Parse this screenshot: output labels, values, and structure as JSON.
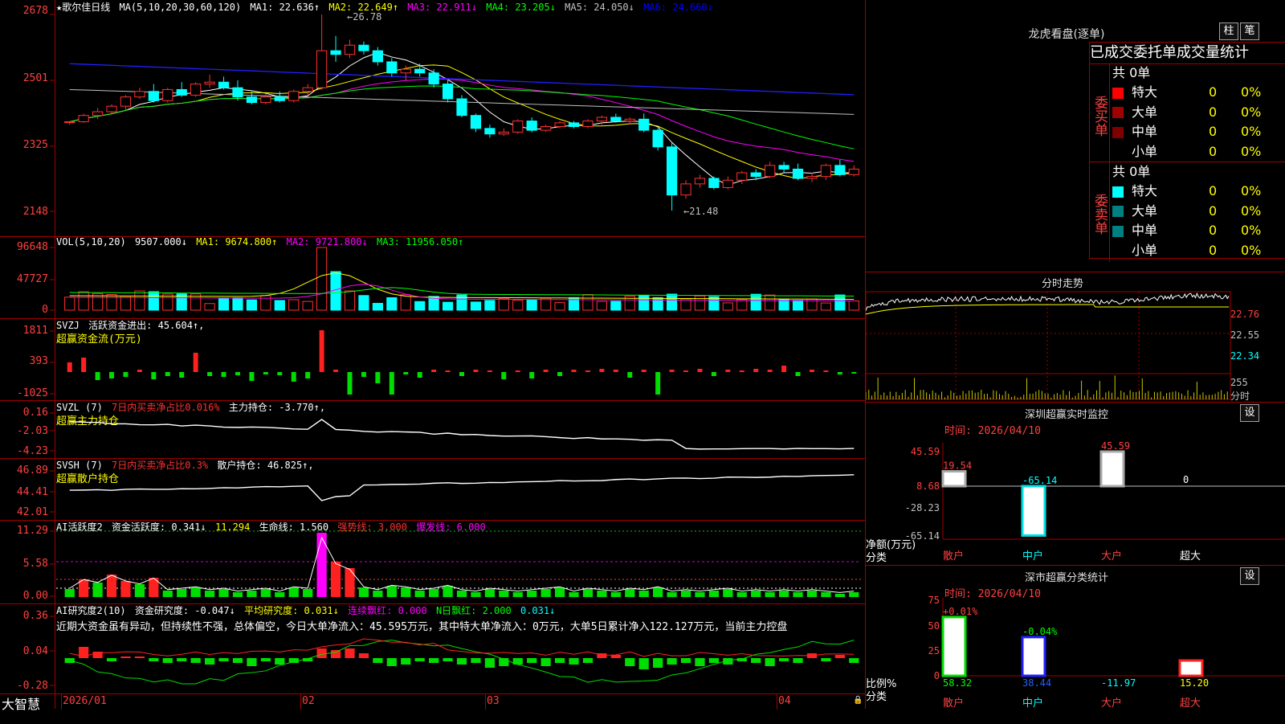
{
  "stock": {
    "title": "★歌尔佳日线",
    "ma_label": "MA(5,10,20,30,60,120)",
    "ma_values": [
      "MA1: 22.636↑",
      "MA2: 22.649↑",
      "MA3: 22.911↓",
      "MA4: 23.205↓",
      "MA5: 24.050↓",
      "MA6: 24.660↓"
    ],
    "ma_colors": [
      "#ffffff",
      "#ffff00",
      "#ff00ff",
      "#00ff00",
      "#c0c0c0",
      "#0000ff"
    ],
    "price_ticks": [
      "2678",
      "2501",
      "2325",
      "2148"
    ],
    "high_label": "26.78",
    "low_label": "21.48"
  },
  "vol": {
    "header": [
      "VOL(5,10,20)",
      "9507.000↓",
      "MA1: 9674.800↑",
      "MA2: 9721.800↓",
      "MA3: 11956.050↑"
    ],
    "ticks": [
      "96648",
      "47727",
      "0"
    ]
  },
  "svzj": {
    "header": [
      "SVZJ",
      "活跃资金进出: 45.604↑,"
    ],
    "sub": "超赢资金流(万元)",
    "ticks": [
      "1811",
      "393",
      "-1025"
    ]
  },
  "svzl": {
    "header": [
      "SVZL (7)",
      "7日内买卖净占比0.016%",
      "主力持仓: -3.770↑,"
    ],
    "sub": "超赢主力持仓",
    "ticks": [
      "0.16",
      "-2.03",
      "-4.23"
    ]
  },
  "svsh": {
    "header": [
      "SVSH (7)",
      "7日内买卖净占比0.3%",
      "散户持仓: 46.825↑,"
    ],
    "sub": "超赢散户持仓",
    "ticks": [
      "46.89",
      "44.41",
      "42.01"
    ]
  },
  "ai1": {
    "header": [
      "AI活跃度2",
      "资金活跃度: 0.341↓",
      "11.294",
      "生命线: 1.560",
      "强势线: 3.000",
      "爆发线: 6.000"
    ],
    "ticks": [
      "11.29",
      "5.58",
      "0.00"
    ]
  },
  "ai2": {
    "header": [
      "AI研究度2(10)",
      "资金研究度: -0.047↓",
      "平均研究度: 0.031↓",
      "连续飘红: 0.000",
      "N日飘红: 2.000",
      "0.031↓"
    ],
    "comment": "近期大资金虽有异动，但持续性不强，总体偏空，今日大单净流入：45.595万元，其中特大单净流入：0万元，大单5日累计净入122.127万元，当前主力控盘",
    "ticks": [
      "0.36",
      "0.04",
      "-0.28"
    ]
  },
  "footer": {
    "brand": "大智慧",
    "dates": [
      "2026/01",
      "02",
      "03",
      "04"
    ]
  },
  "right": {
    "title": "龙虎看盘(逐单)",
    "btn_zhu": "柱",
    "btn_bi": "笔",
    "stat_header": "已成交委托单成交量统计",
    "buy_side": "委买单",
    "sell_side": "委卖单",
    "buy_total": "共 0单",
    "sell_total": "共 0单",
    "rows": [
      {
        "name": "特大",
        "qty": "0",
        "pct": "0%"
      },
      {
        "name": "大单",
        "qty": "0",
        "pct": "0%"
      },
      {
        "name": "中单",
        "qty": "0",
        "pct": "0%"
      },
      {
        "name": "小单",
        "qty": "0",
        "pct": "0%"
      }
    ],
    "buy_colors": [
      "#ff0000",
      "#a00000",
      "#800000",
      "#000000"
    ],
    "sell_colors": [
      "#00ffff",
      "#008080",
      "#008080",
      "#000000"
    ],
    "minute_title": "分时走势",
    "minute_ticks": [
      "22.76",
      "22.55",
      "22.34"
    ],
    "minute_vol_tick": "255",
    "minute_vol_unit": "分时",
    "sz_title": "深圳超赢实时监控",
    "sz_btn": "设",
    "sz_time": "时间: 2026/04/10",
    "sz_ticks": [
      "45.59",
      "8.68",
      "0",
      "-28.23",
      "-65.14"
    ],
    "sz_ylabel": "净额(万元)",
    "sz_xlabel": "分类",
    "sz_categories": [
      "散户",
      "中户",
      "大户",
      "超大"
    ],
    "sz_values": [
      "19.54",
      "-65.14",
      "45.59",
      "0"
    ],
    "sh_title": "深市超赢分类统计",
    "sh_btn": "设",
    "sh_time": "时间: 2026/04/10",
    "sh_ticks": [
      "75",
      "50",
      "25",
      "0"
    ],
    "sh_ylabel": "比例%",
    "sh_xlabel": "分类",
    "sh_categories": [
      "散户",
      "中户",
      "大户",
      "超大"
    ],
    "sh_top_labels": [
      "+0.01%",
      "-0.04%"
    ],
    "sh_bottom_values": [
      "58.32",
      "38.44",
      "-11.97",
      "15.20"
    ]
  },
  "chart_data": [
    {
      "type": "candlestick",
      "title": "歌尔佳日线",
      "ylim": [
        21.48,
        26.78
      ],
      "x_labels": [
        "2026/01",
        "02",
        "03",
        "04"
      ],
      "candles": [
        [
          23.86,
          23.9,
          23.8,
          23.88
        ],
        [
          23.88,
          24.1,
          23.85,
          24.05
        ],
        [
          24.05,
          24.25,
          23.95,
          24.15
        ],
        [
          24.15,
          24.35,
          24.1,
          24.3
        ],
        [
          24.3,
          24.6,
          24.2,
          24.55
        ],
        [
          24.55,
          24.8,
          24.5,
          24.7
        ],
        [
          24.7,
          24.9,
          24.4,
          24.45
        ],
        [
          24.45,
          24.8,
          24.4,
          24.75
        ],
        [
          24.75,
          24.95,
          24.55,
          24.6
        ],
        [
          24.6,
          24.95,
          24.55,
          24.9
        ],
        [
          24.9,
          25.15,
          24.8,
          24.95
        ],
        [
          24.95,
          25.1,
          24.75,
          24.8
        ],
        [
          24.8,
          25.0,
          24.45,
          24.55
        ],
        [
          24.55,
          24.7,
          24.35,
          24.4
        ],
        [
          24.4,
          24.65,
          24.35,
          24.55
        ],
        [
          24.55,
          24.7,
          24.4,
          24.45
        ],
        [
          24.45,
          24.75,
          24.4,
          24.7
        ],
        [
          24.7,
          24.9,
          24.6,
          24.8
        ],
        [
          24.8,
          26.78,
          24.75,
          25.8
        ],
        [
          25.8,
          26.2,
          25.5,
          25.7
        ],
        [
          25.7,
          26.1,
          25.6,
          25.95
        ],
        [
          25.95,
          26.05,
          25.7,
          25.8
        ],
        [
          25.8,
          25.9,
          25.4,
          25.5
        ],
        [
          25.5,
          25.6,
          25.1,
          25.2
        ],
        [
          25.2,
          25.4,
          25.0,
          25.3
        ],
        [
          25.3,
          25.45,
          25.1,
          25.2
        ],
        [
          25.2,
          25.3,
          24.8,
          24.9
        ],
        [
          24.9,
          25.0,
          24.4,
          24.5
        ],
        [
          24.5,
          24.6,
          24.0,
          24.05
        ],
        [
          24.05,
          24.1,
          23.6,
          23.7
        ],
        [
          23.7,
          23.8,
          23.45,
          23.55
        ],
        [
          23.55,
          23.7,
          23.5,
          23.6
        ],
        [
          23.6,
          23.95,
          23.55,
          23.9
        ],
        [
          23.9,
          24.0,
          23.6,
          23.65
        ],
        [
          23.65,
          23.8,
          23.6,
          23.75
        ],
        [
          23.75,
          23.9,
          23.7,
          23.85
        ],
        [
          23.85,
          23.9,
          23.7,
          23.75
        ],
        [
          23.75,
          23.95,
          23.7,
          23.9
        ],
        [
          23.9,
          24.05,
          23.8,
          24.0
        ],
        [
          24.0,
          24.1,
          23.85,
          23.9
        ],
        [
          23.9,
          24.0,
          23.8,
          23.95
        ],
        [
          23.95,
          24.1,
          23.6,
          23.65
        ],
        [
          23.65,
          23.7,
          23.1,
          23.2
        ],
        [
          23.2,
          23.3,
          21.48,
          21.9
        ],
        [
          21.9,
          22.3,
          21.8,
          22.2
        ],
        [
          22.2,
          22.45,
          22.1,
          22.35
        ],
        [
          22.35,
          22.4,
          22.05,
          22.1
        ],
        [
          22.1,
          22.4,
          22.05,
          22.3
        ],
        [
          22.3,
          22.55,
          22.2,
          22.5
        ],
        [
          22.5,
          22.6,
          22.3,
          22.4
        ],
        [
          22.4,
          22.8,
          22.35,
          22.7
        ],
        [
          22.7,
          22.8,
          22.5,
          22.6
        ],
        [
          22.6,
          22.75,
          22.3,
          22.35
        ],
        [
          22.35,
          22.5,
          22.25,
          22.4
        ],
        [
          22.4,
          22.75,
          22.3,
          22.7
        ],
        [
          22.7,
          22.85,
          22.4,
          22.45
        ],
        [
          22.45,
          22.7,
          22.4,
          22.6
        ]
      ]
    }
  ]
}
